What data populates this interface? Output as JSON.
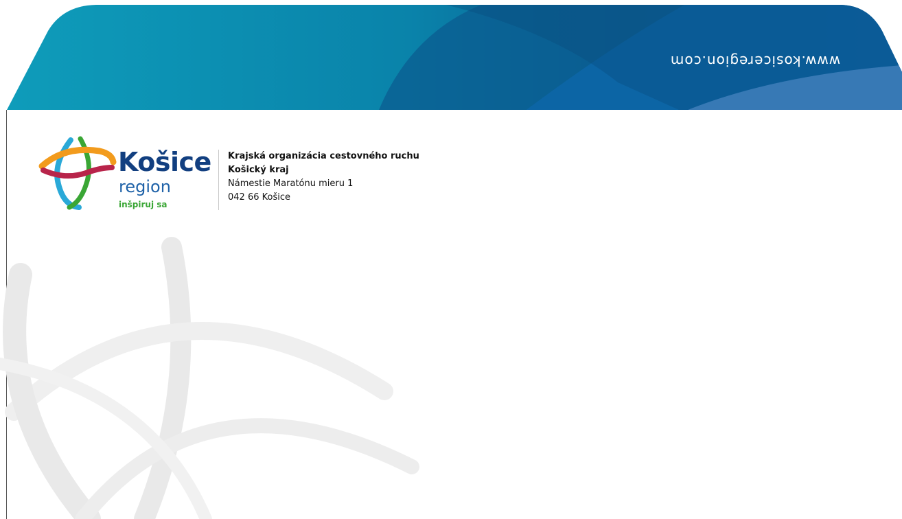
{
  "envelope": {
    "url": "www.kosiceregion.com",
    "colors": {
      "flap_teal": "#0a8fb0",
      "flap_blue": "#0d5f95",
      "flap_dark": "#0b4a7d",
      "flap_light": "#3a7bbd"
    }
  },
  "logo": {
    "wordmark": "Košice",
    "subtitle": "region",
    "tagline": "inšpiruj sa",
    "colors": {
      "navy": "#123f80",
      "blue": "#1f62a8",
      "green": "#3aa635",
      "orange": "#f29b1d",
      "crimson": "#b8244a",
      "cyan": "#2aa9d8"
    }
  },
  "address": {
    "line1": "Krajská organizácia cestovného ruchu",
    "line2": "Košický kraj",
    "line3": "Námestie Maratónu mieru 1",
    "line4": "042 66 Košice"
  }
}
